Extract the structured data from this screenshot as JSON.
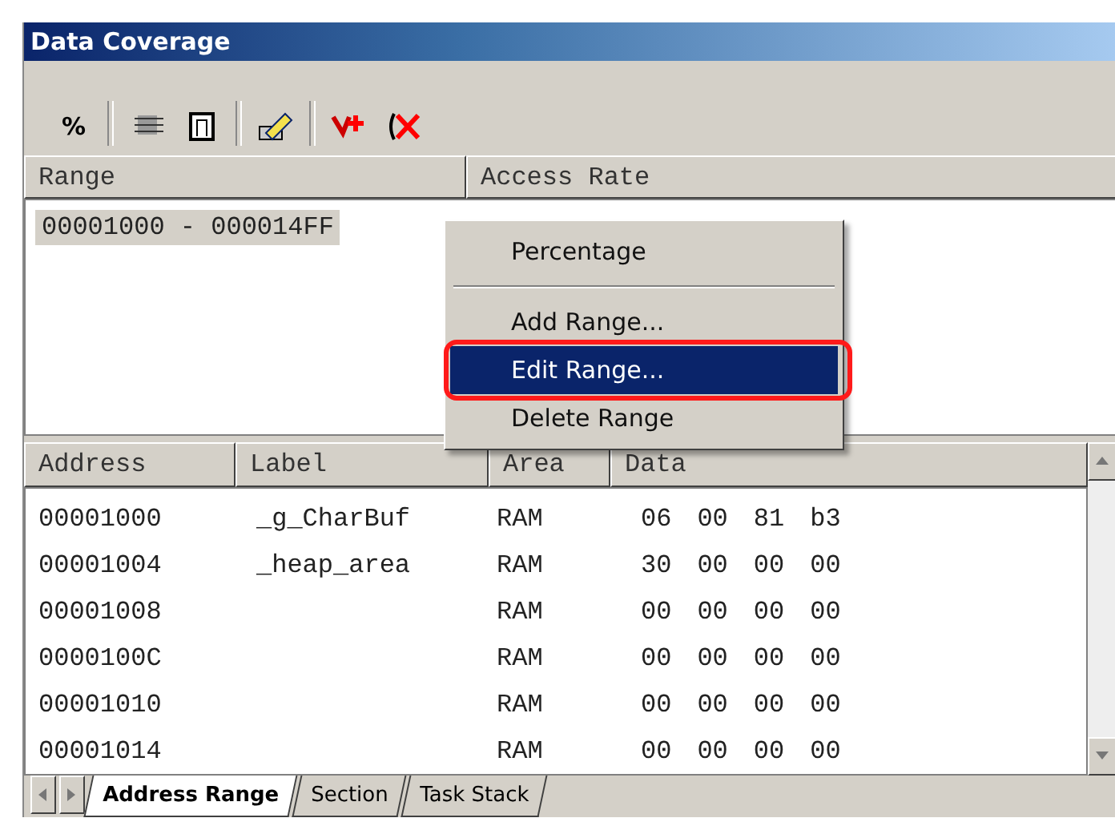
{
  "window": {
    "title": "Data Coverage"
  },
  "toolbar": {
    "buttons": [
      {
        "kind": "text",
        "label": "%"
      },
      {
        "kind": "sep"
      },
      {
        "kind": "chip"
      },
      {
        "kind": "frame"
      },
      {
        "kind": "sep"
      },
      {
        "kind": "pen"
      },
      {
        "kind": "sep"
      },
      {
        "kind": "add"
      },
      {
        "kind": "delete"
      }
    ]
  },
  "range_list": {
    "columns": [
      "Range",
      "Access Rate"
    ],
    "rows": [
      {
        "range": "00001000 - 000014FF",
        "selected": true
      }
    ]
  },
  "context_menu": {
    "items": [
      {
        "kind": "item",
        "label": "Percentage",
        "selected": false
      },
      {
        "kind": "separator"
      },
      {
        "kind": "item",
        "label": "Add Range...",
        "selected": false
      },
      {
        "kind": "item",
        "label": "Edit Range...",
        "selected": true,
        "highlighted_outline": true
      },
      {
        "kind": "item",
        "label": "Delete Range",
        "selected": false
      }
    ]
  },
  "memory_table": {
    "columns": [
      "Address",
      "Label",
      "Area",
      "Data"
    ],
    "rows": [
      {
        "address": "00001000",
        "label": "_g_CharBuf",
        "area": "RAM",
        "data": [
          "06",
          "00",
          "81",
          "b3"
        ]
      },
      {
        "address": "00001004",
        "label": "_heap_area",
        "area": "RAM",
        "data": [
          "30",
          "00",
          "00",
          "00"
        ]
      },
      {
        "address": "00001008",
        "label": "",
        "area": "RAM",
        "data": [
          "00",
          "00",
          "00",
          "00"
        ]
      },
      {
        "address": "0000100C",
        "label": "",
        "area": "RAM",
        "data": [
          "00",
          "00",
          "00",
          "00"
        ]
      },
      {
        "address": "00001010",
        "label": "",
        "area": "RAM",
        "data": [
          "00",
          "00",
          "00",
          "00"
        ]
      },
      {
        "address": "00001014",
        "label": "",
        "area": "RAM",
        "data": [
          "00",
          "00",
          "00",
          "00"
        ]
      }
    ]
  },
  "tabs": [
    {
      "label": "Address Range",
      "selected": true
    },
    {
      "label": "Section",
      "selected": false
    },
    {
      "label": "Task Stack",
      "selected": false
    }
  ]
}
